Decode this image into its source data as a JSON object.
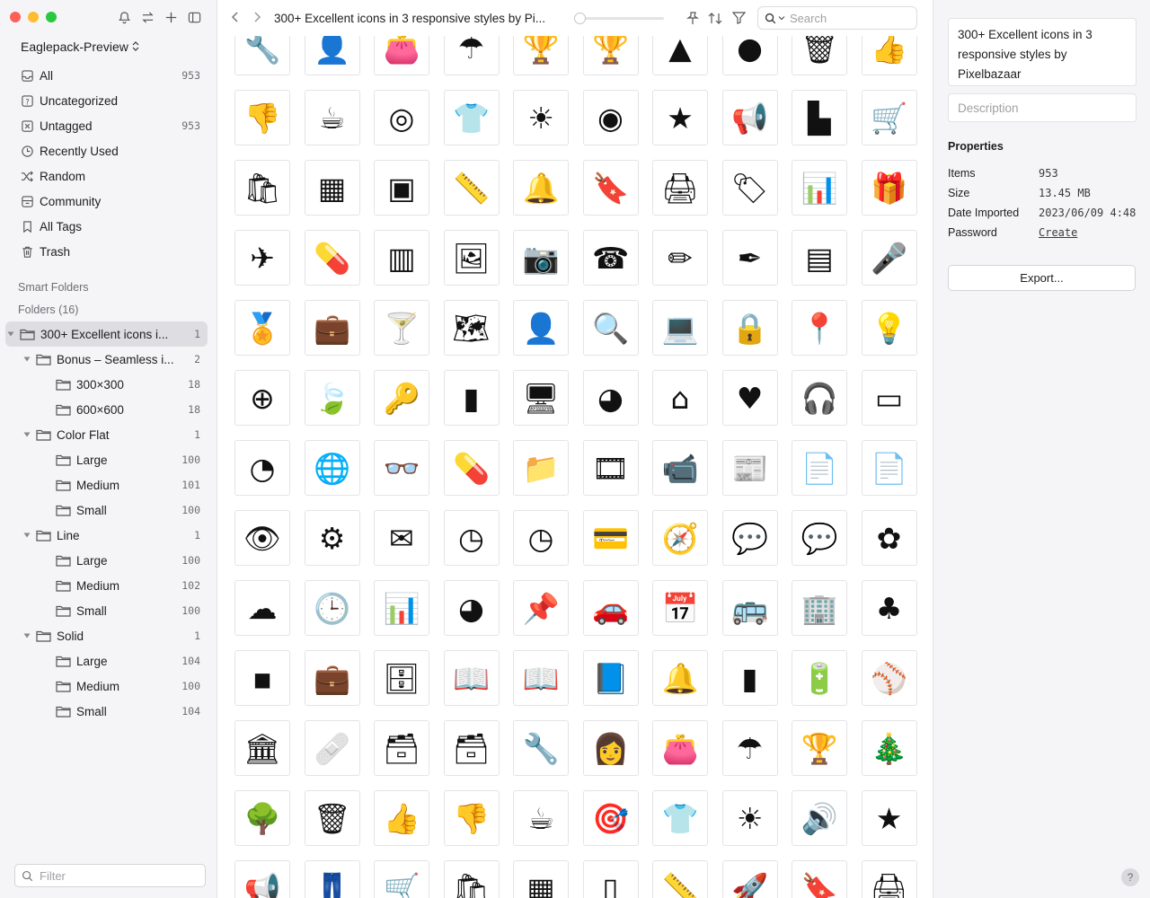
{
  "window": {
    "library_name": "Eaglepack-Preview",
    "breadcrumb_title": "300+ Excellent icons in 3 responsive styles by Pi..."
  },
  "sidebar": {
    "nav": [
      {
        "label": "All",
        "count": "953",
        "icon": "inbox-icon"
      },
      {
        "label": "Uncategorized",
        "count": "",
        "icon": "question-box-icon"
      },
      {
        "label": "Untagged",
        "count": "953",
        "icon": "untagged-icon"
      },
      {
        "label": "Recently Used",
        "count": "",
        "icon": "clock-icon"
      },
      {
        "label": "Random",
        "count": "",
        "icon": "shuffle-icon"
      },
      {
        "label": "Community",
        "count": "",
        "icon": "community-icon"
      },
      {
        "label": "All Tags",
        "count": "",
        "icon": "bookmark-icon"
      },
      {
        "label": "Trash",
        "count": "",
        "icon": "trash-icon"
      }
    ],
    "smart_folders_label": "Smart Folders",
    "folders_label": "Folders (16)",
    "tree": [
      {
        "label": "300+ Excellent icons i...",
        "count": "1",
        "depth": 0,
        "toggle": "open",
        "selected": true
      },
      {
        "label": "Bonus – Seamless i...",
        "count": "2",
        "depth": 1,
        "toggle": "open"
      },
      {
        "label": "300×300",
        "count": "18",
        "depth": 2,
        "toggle": ""
      },
      {
        "label": "600×600",
        "count": "18",
        "depth": 2,
        "toggle": ""
      },
      {
        "label": "Color Flat",
        "count": "1",
        "depth": 1,
        "toggle": "open"
      },
      {
        "label": "Large",
        "count": "100",
        "depth": 2,
        "toggle": ""
      },
      {
        "label": "Medium",
        "count": "101",
        "depth": 2,
        "toggle": ""
      },
      {
        "label": "Small",
        "count": "100",
        "depth": 2,
        "toggle": ""
      },
      {
        "label": "Line",
        "count": "1",
        "depth": 1,
        "toggle": "open"
      },
      {
        "label": "Large",
        "count": "100",
        "depth": 2,
        "toggle": ""
      },
      {
        "label": "Medium",
        "count": "102",
        "depth": 2,
        "toggle": ""
      },
      {
        "label": "Small",
        "count": "100",
        "depth": 2,
        "toggle": ""
      },
      {
        "label": "Solid",
        "count": "1",
        "depth": 1,
        "toggle": "open"
      },
      {
        "label": "Large",
        "count": "104",
        "depth": 2,
        "toggle": ""
      },
      {
        "label": "Medium",
        "count": "100",
        "depth": 2,
        "toggle": ""
      },
      {
        "label": "Small",
        "count": "104",
        "depth": 2,
        "toggle": ""
      }
    ],
    "filter_placeholder": "Filter"
  },
  "toolbar": {
    "search_placeholder": "Search"
  },
  "grid": {
    "icons": [
      "🔧",
      "👤",
      "👛",
      "☂",
      "🏆",
      "🏆",
      "▲",
      "●",
      "🗑",
      "👍",
      "👎",
      "☕",
      "◎",
      "👕",
      "☀",
      "◉",
      "★",
      "📢",
      "▙",
      "🛒",
      "🛍",
      "▦",
      "▣",
      "📏",
      "🔔",
      "🔖",
      "🖨",
      "🏷",
      "📊",
      "🎁",
      "✈",
      "💊",
      "▥",
      "🖼",
      "📷",
      "☎",
      "✏",
      "✒",
      "▤",
      "🎤",
      "🏅",
      "💼",
      "🍸",
      "🗺",
      "👤",
      "🔍",
      "💻",
      "🔒",
      "📍",
      "💡",
      "⊕",
      "🍃",
      "🔑",
      "▮",
      "🖥",
      "◕",
      "⌂",
      "♥",
      "🎧",
      "▭",
      "◔",
      "🌐",
      "👓",
      "💊",
      "📁",
      "🎞",
      "📹",
      "📰",
      "📄",
      "📄",
      "👁",
      "⚙",
      "✉",
      "◷",
      "◷",
      "💳",
      "🧭",
      "💬",
      "💬",
      "✿",
      "☁",
      "🕒",
      "📊",
      "◕",
      "📌",
      "🚗",
      "📅",
      "🚌",
      "🏢",
      "♣",
      "▪",
      "💼",
      "🗄",
      "📖",
      "📖",
      "📘",
      "🔔",
      "▮",
      "🔋",
      "⚾",
      "🏛",
      "🩹",
      "🗃",
      "🗃",
      "🔧",
      "👩",
      "👛",
      "☂",
      "🏆",
      "🎄",
      "🌳",
      "🗑",
      "👍",
      "👎",
      "☕",
      "🎯",
      "👕",
      "☀",
      "🔊",
      "★",
      "📢",
      "👖",
      "🛒",
      "🛍",
      "▦",
      "▯",
      "📏",
      "🚀",
      "🔖",
      "🖨"
    ]
  },
  "inspector": {
    "name": "300+ Excellent icons in 3 responsive styles by Pixelbazaar",
    "description_placeholder": "Description",
    "properties_title": "Properties",
    "properties": [
      {
        "key": "Items",
        "value": "953"
      },
      {
        "key": "Size",
        "value": "13.45 MB"
      },
      {
        "key": "Date Imported",
        "value": "2023/06/09 4:48"
      },
      {
        "key": "Password",
        "value": "Create"
      }
    ],
    "export_label": "Export...",
    "help_label": "?"
  }
}
